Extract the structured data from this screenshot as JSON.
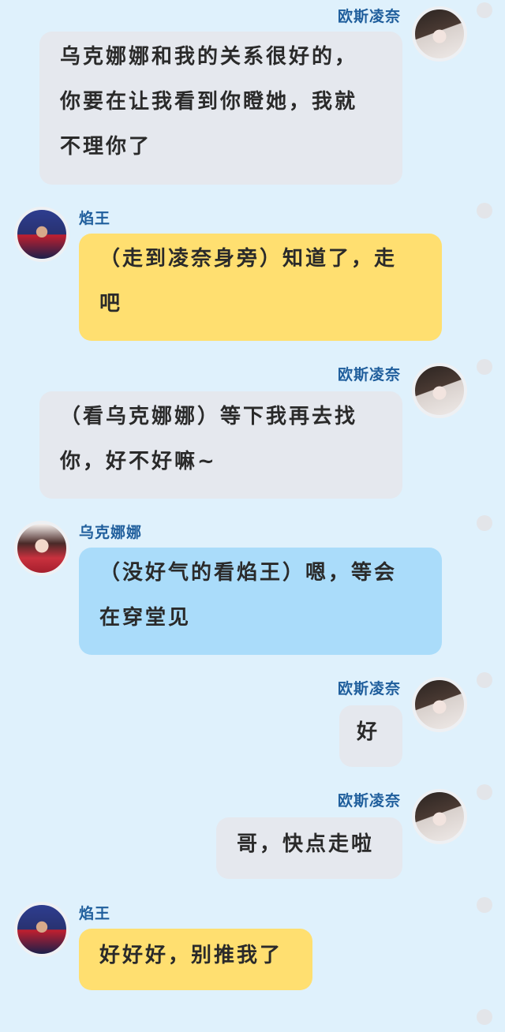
{
  "messages": [
    {
      "side": "right",
      "name": "欧斯凌奈",
      "avatar": "girl-avatar",
      "color": "gray",
      "lines": [
        "乌克娜娜和我的关系很好的，",
        "你要在让我看到你瞪她，我就",
        "不理你了"
      ]
    },
    {
      "side": "left",
      "name": "焰王",
      "avatar": "boy-avatar",
      "color": "yellow",
      "lines": [
        "（走到凌奈身旁）知道了，走",
        "吧"
      ]
    },
    {
      "side": "right",
      "name": "欧斯凌奈",
      "avatar": "girl-avatar",
      "color": "gray",
      "lines": [
        "（看乌克娜娜）等下我再去找",
        "你，好不好嘛~"
      ]
    },
    {
      "side": "left",
      "name": "乌克娜娜",
      "avatar": "woman-avatar",
      "color": "blue",
      "lines": [
        "（没好气的看焰王）嗯，等会",
        "在穿堂见"
      ]
    },
    {
      "side": "right",
      "name": "欧斯凌奈",
      "avatar": "girl-avatar",
      "color": "gray",
      "lines": [
        "好"
      ]
    },
    {
      "side": "right",
      "name": "欧斯凌奈",
      "avatar": "girl-avatar",
      "color": "gray",
      "lines": [
        "哥，快点走啦"
      ]
    },
    {
      "side": "left",
      "name": "焰王",
      "avatar": "boy-avatar",
      "color": "yellow",
      "lines": [
        "好好好，别推我了"
      ]
    }
  ]
}
